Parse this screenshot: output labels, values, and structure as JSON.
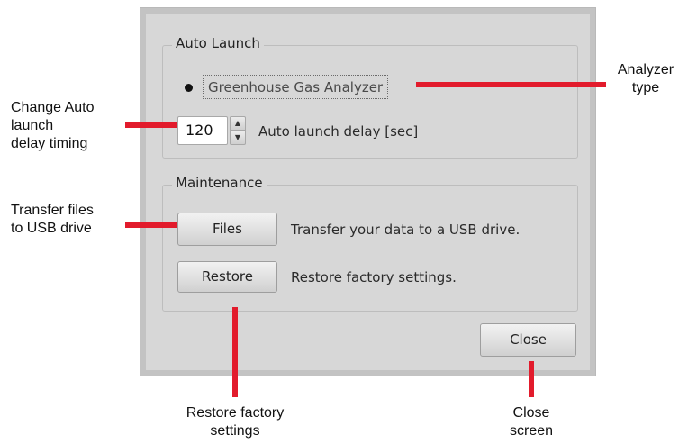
{
  "dialog": {
    "auto_launch": {
      "title": "Auto Launch",
      "analyzer_option": "Greenhouse Gas Analyzer",
      "delay_value": "120",
      "delay_label": "Auto launch delay [sec]",
      "up_glyph": "▲",
      "down_glyph": "▼"
    },
    "maintenance": {
      "title": "Maintenance",
      "files_button": "Files",
      "files_desc": "Transfer your data to a USB drive.",
      "restore_button": "Restore",
      "restore_desc": "Restore factory settings."
    },
    "close_button": "Close"
  },
  "annotations": {
    "analyzer_type": [
      "Analyzer",
      "type"
    ],
    "change_delay": [
      "Change Auto",
      "launch",
      "delay timing"
    ],
    "transfer_files": [
      "Transfer files",
      "to USB drive"
    ],
    "restore_factory": [
      "Restore factory",
      "settings"
    ],
    "close_screen": [
      "Close",
      "screen"
    ]
  },
  "colors": {
    "callout": "#e21b2c",
    "dialog_bg": "#d7d7d7"
  }
}
